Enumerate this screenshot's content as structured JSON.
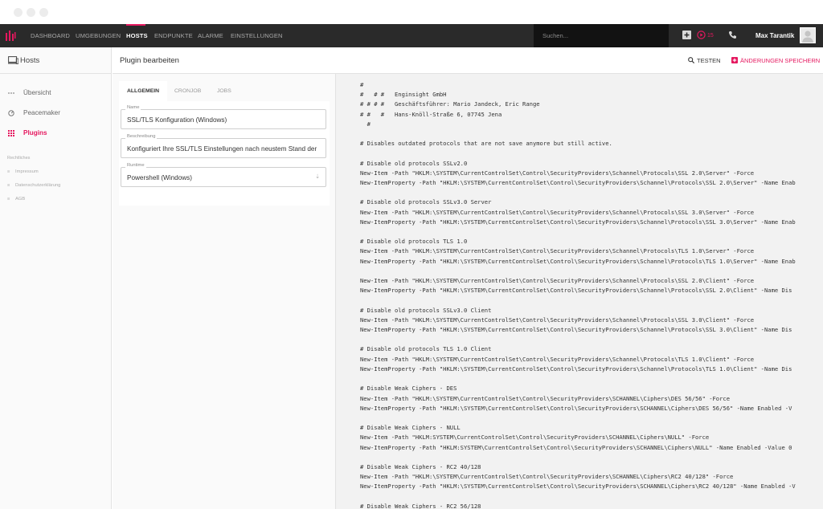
{
  "navbar": {
    "items": [
      "DASHBOARD",
      "UMGEBUNGEN",
      "HOSTS",
      "ENDPUNKTE",
      "ALARME",
      "EINSTELLUNGEN"
    ],
    "active_item": "HOSTS",
    "search_placeholder": "Suchen...",
    "alarm_count": "15",
    "user_name": "Max Tarantik",
    "accent_color": "#e5185f",
    "icons": [
      "logo-icon",
      "add-icon",
      "alarm-icon",
      "phone-icon",
      "avatar"
    ]
  },
  "sidebar": {
    "title": "Hosts",
    "items": [
      {
        "label": "Übersicht",
        "icon": "dots-icon",
        "active": false
      },
      {
        "label": "Peacemaker",
        "icon": "gauge-icon",
        "active": false
      },
      {
        "label": "Plugins",
        "icon": "plugin-grid-icon",
        "active": true
      }
    ],
    "legal_heading": "Rechtliches",
    "legal_items": [
      "Impressum",
      "Datenschutzerklärung",
      "AGB"
    ]
  },
  "page": {
    "title": "Plugin bearbeiten",
    "test_label": "TESTEN",
    "save_label": "ÄNDERUNGEN SPEICHERN"
  },
  "form": {
    "tabs": [
      "ALLGEMEIN",
      "CRONJOB",
      "JOBS"
    ],
    "active_tab": "ALLGEMEIN",
    "name_label": "Name",
    "name_value": "SSL/TLS Konfiguration (Windows)",
    "description_label": "Beschreibung",
    "description_value": "Konfiguriert Ihre SSL/TLS Einstellungen nach neustem Stand der",
    "runtime_label": "Runtime",
    "runtime_value": "Powershell (Windows)"
  },
  "code_lines": [
    "#",
    "#   # #   Enginsight GmbH",
    "# # # #   Geschäftsführer: Mario Jandeck, Eric Range",
    "# #   #   Hans-Knöll-Straße 6, 07745 Jena",
    "  #",
    "",
    "# Disables outdated protocols that are not save anymore but still active.",
    "",
    "# Disable old protocols SSLv2.0",
    "New-Item -Path \"HKLM:\\SYSTEM\\CurrentControlSet\\Control\\SecurityProviders\\Schannel\\Protocols\\SSL 2.0\\Server\" -Force",
    "New-ItemProperty -Path \"HKLM:\\SYSTEM\\CurrentControlSet\\Control\\SecurityProviders\\Schannel\\Protocols\\SSL 2.0\\Server\" -Name Enab",
    "",
    "# Disable old protocols SSLv3.0 Server",
    "New-Item -Path \"HKLM:\\SYSTEM\\CurrentControlSet\\Control\\SecurityProviders\\Schannel\\Protocols\\SSL 3.0\\Server\" -Force",
    "New-ItemProperty -Path \"HKLM:\\SYSTEM\\CurrentControlSet\\Control\\SecurityProviders\\Schannel\\Protocols\\SSL 3.0\\Server\" -Name Enab",
    "",
    "# Disable old protocols TLS 1.0",
    "New-Item -Path \"HKLM:\\SYSTEM\\CurrentControlSet\\Control\\SecurityProviders\\Schannel\\Protocols\\TLS 1.0\\Server\" -Force",
    "New-ItemProperty -Path \"HKLM:\\SYSTEM\\CurrentControlSet\\Control\\SecurityProviders\\Schannel\\Protocols\\TLS 1.0\\Server\" -Name Enab",
    "",
    "New-Item -Path \"HKLM:\\SYSTEM\\CurrentControlSet\\Control\\SecurityProviders\\Schannel\\Protocols\\SSL 2.0\\Client\" -Force",
    "New-ItemProperty -Path \"HKLM:\\SYSTEM\\CurrentControlSet\\Control\\SecurityProviders\\Schannel\\Protocols\\SSL 2.0\\Client\" -Name Dis",
    "",
    "# Disable old protocols SSLv3.0 Client",
    "New-Item -Path \"HKLM:\\SYSTEM\\CurrentControlSet\\Control\\SecurityProviders\\Schannel\\Protocols\\SSL 3.0\\Client\" -Force",
    "New-ItemProperty -Path \"HKLM:\\SYSTEM\\CurrentControlSet\\Control\\SecurityProviders\\Schannel\\Protocols\\SSL 3.0\\Client\" -Name Dis",
    "",
    "# Disable old protocols TLS 1.0 Client",
    "New-Item -Path \"HKLM:\\SYSTEM\\CurrentControlSet\\Control\\SecurityProviders\\Schannel\\Protocols\\TLS 1.0\\Client\" -Force",
    "New-ItemProperty -Path \"HKLM:\\SYSTEM\\CurrentControlSet\\Control\\SecurityProviders\\Schannel\\Protocols\\TLS 1.0\\Client\" -Name Dis",
    "",
    "# Disable Weak Ciphers - DES",
    "New-Item -Path \"HKLM:\\SYSTEM\\CurrentControlSet\\Control\\SecurityProviders\\SCHANNEL\\Ciphers\\DES 56/56\" -Force",
    "New-ItemProperty -Path \"HKLM:\\SYSTEM\\CurrentControlSet\\Control\\SecurityProviders\\SCHANNEL\\Ciphers\\DES 56/56\" -Name Enabled -V",
    "",
    "# Disable Weak Ciphers - NULL",
    "New-Item -Path \"HKLM:SYSTEM\\CurrentControlSet\\Control\\SecurityProviders\\SCHANNEL\\Ciphers\\NULL\" -Force",
    "New-ItemProperty -Path \"HKLM:SYSTEM\\CurrentControlSet\\Control\\SecurityProviders\\SCHANNEL\\Ciphers\\NULL\" -Name Enabled -Value 0",
    "",
    "# Disable Weak Ciphers - RC2 40/128",
    "New-Item -Path \"HKLM:\\SYSTEM\\CurrentControlSet\\Control\\SecurityProviders\\SCHANNEL\\Ciphers\\RC2 40/128\" -Force",
    "New-ItemProperty -Path \"HKLM:\\SYSTEM\\CurrentControlSet\\Control\\SecurityProviders\\SCHANNEL\\Ciphers\\RC2 40/128\" -Name Enabled -V",
    "",
    "# Disable Weak Ciphers - RC2 56/128"
  ]
}
